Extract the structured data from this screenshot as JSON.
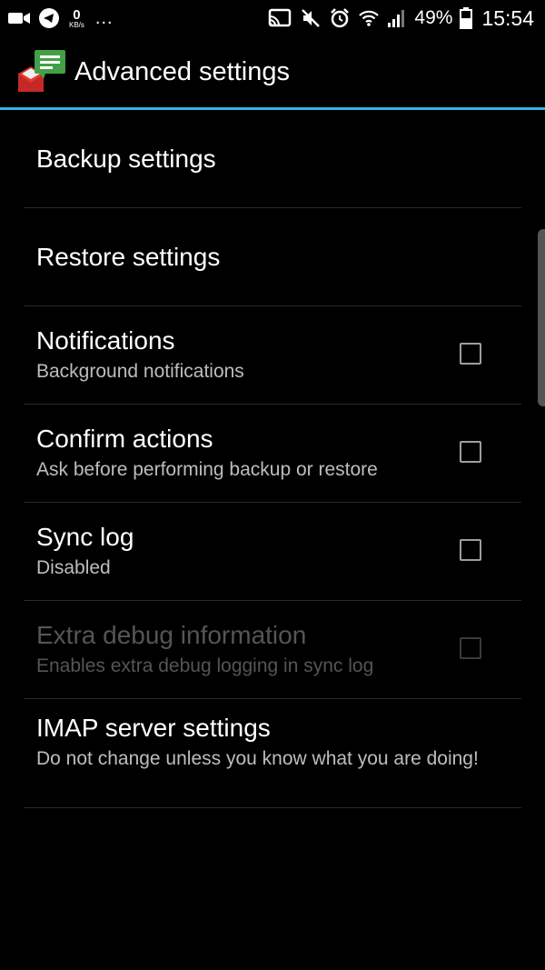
{
  "status_bar": {
    "net_speed_value": "0",
    "net_speed_unit": "KB/s",
    "more": "...",
    "battery_percent": "49%",
    "time": "15:54"
  },
  "app_bar": {
    "title": "Advanced settings"
  },
  "settings": {
    "backup": {
      "title": "Backup settings"
    },
    "restore": {
      "title": "Restore settings"
    },
    "notifications": {
      "title": "Notifications",
      "summary": "Background notifications",
      "checked": false
    },
    "confirm": {
      "title": "Confirm actions",
      "summary": "Ask before performing backup or restore",
      "checked": false
    },
    "sync_log": {
      "title": "Sync log",
      "summary": "Disabled",
      "checked": false
    },
    "extra_debug": {
      "title": "Extra debug information",
      "summary": "Enables extra debug logging in sync log",
      "checked": false,
      "enabled": false
    },
    "imap": {
      "title": "IMAP server settings",
      "summary": "Do not change unless you know what you are doing!"
    }
  },
  "colors": {
    "accent": "#33b5e5",
    "background": "#000000",
    "summary_text": "#bdbdbd"
  }
}
